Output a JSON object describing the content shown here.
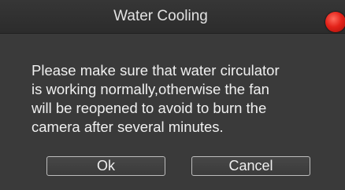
{
  "dialog": {
    "title": "Water Cooling",
    "message": "Please make sure that water circulator\nis working normally,otherwise the fan\nwill be reopened to avoid to burn the\ncamera after several minutes.",
    "ok_label": "Ok",
    "cancel_label": "Cancel",
    "close_icon": "close-circle-icon"
  },
  "colors": {
    "background": "#3a3a3a",
    "close_button": "#e3231a"
  }
}
